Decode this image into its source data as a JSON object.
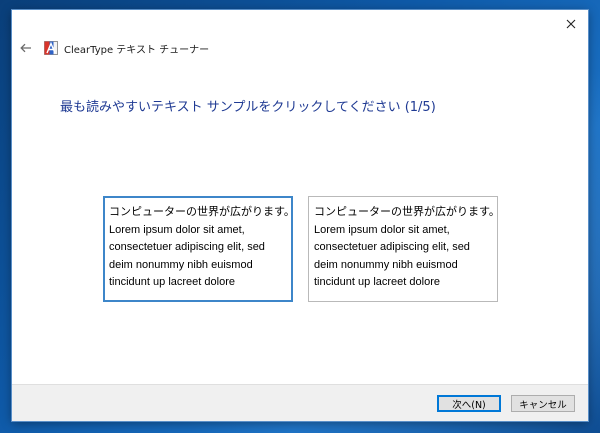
{
  "window": {
    "app_title": "ClearType テキスト チューナー",
    "close_label": "✕",
    "back_label": "←"
  },
  "instruction": "最も読みやすいテキスト サンプルをクリックしてください (1/5)",
  "samples": [
    {
      "lines": [
        "コンピューターの世界が広がります。",
        "Lorem ipsum dolor sit amet,",
        "consectetuer adipiscing elit, sed",
        "deim nonummy nibh euismod",
        "tincidunt up lacreet dolore"
      ],
      "selected": true
    },
    {
      "lines": [
        "コンピューターの世界が広がります。",
        "Lorem ipsum dolor sit amet,",
        "consectetuer adipiscing elit, sed",
        "deim nonummy nibh euismod",
        "tincidunt up lacreet dolore"
      ],
      "selected": false
    }
  ],
  "footer": {
    "next_label": "次へ(N)",
    "cancel_label": "キャンセル"
  },
  "colors": {
    "accent": "#0078d7",
    "instruction_text": "#1f3a93",
    "selected_border": "#3d86c9"
  }
}
